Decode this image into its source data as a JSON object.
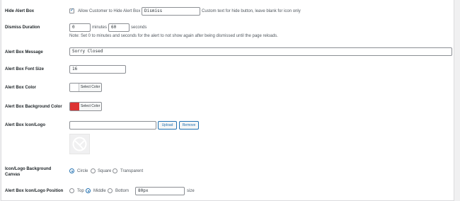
{
  "hide_alert_box": {
    "label": "Hide Alert Box",
    "checked": true,
    "checkbox_label": "Allow Customer to Hide Alert Box",
    "button_text_value": "Dismiss",
    "help_text": "Custom text for hide button, leave blank for icon only"
  },
  "dismiss_duration": {
    "label": "Dismiss Duration",
    "minutes_value": "0",
    "minutes_unit": "minutes",
    "seconds_value": "60",
    "seconds_unit": "seconds",
    "note": "Note: Set 0 to minutes and seconds for the alert to not show again after being dismissed until the page reloads."
  },
  "alert_box_message": {
    "label": "Alert Box Message",
    "value": "Sorry Closed"
  },
  "alert_box_font_size": {
    "label": "Alert Box Font Size",
    "value": "16"
  },
  "alert_box_color": {
    "label": "Alert Box Color",
    "button_label": "Select Color",
    "swatch": "#ffffff"
  },
  "alert_box_background_color": {
    "label": "Alert Box Background Color",
    "button_label": "Select Color",
    "swatch": "#dd3333"
  },
  "alert_box_icon": {
    "label": "Alert Box Icon/Logo",
    "url_value": "",
    "upload_label": "Upload",
    "remove_label": "Remove",
    "preview_icon": "logo-placeholder-icon"
  },
  "logo_background_canvas": {
    "label": "Icon/Logo Background Canvas",
    "options": [
      "Circle",
      "Square",
      "Transparent"
    ],
    "selected": "Circle"
  },
  "logo_position": {
    "label": "Alert Box Icon/Logo Position",
    "options": [
      "Top",
      "Middle",
      "Bottom"
    ],
    "selected": "Middle",
    "size_value": "80px",
    "size_unit": "size"
  },
  "colors": {
    "accent": "#2271b1",
    "background": "#f0f0f1",
    "panel": "#ffffff"
  }
}
